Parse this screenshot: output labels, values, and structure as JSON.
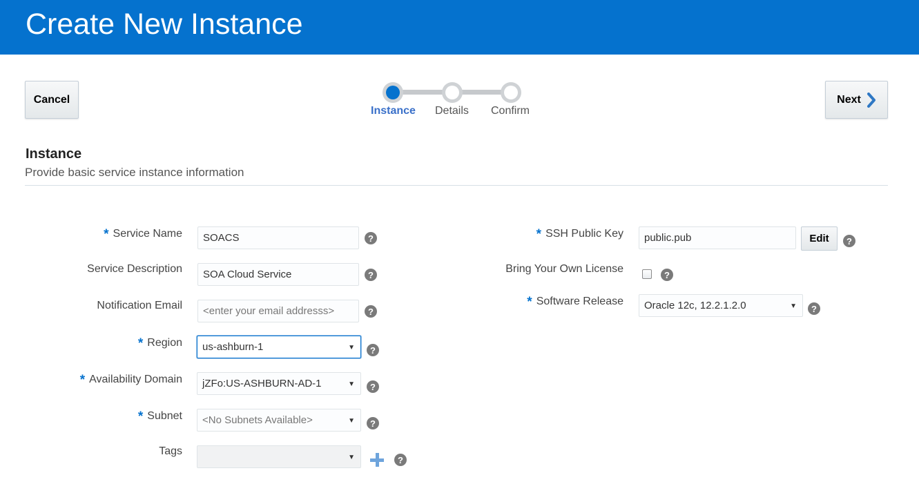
{
  "header": {
    "title": "Create New Instance"
  },
  "toolbar": {
    "cancel_label": "Cancel",
    "next_label": "Next"
  },
  "train": {
    "steps": [
      "Instance",
      "Details",
      "Confirm"
    ],
    "active": "Instance"
  },
  "section": {
    "title": "Instance",
    "subtitle": "Provide basic service instance information"
  },
  "form": {
    "service_name": {
      "label": "Service Name",
      "value": "SOACS",
      "required": "*"
    },
    "service_description": {
      "label": "Service Description",
      "value": "SOA Cloud Service"
    },
    "notification_email": {
      "label": "Notification Email",
      "placeholder": "<enter your email addresss>"
    },
    "region": {
      "label": "Region",
      "value": "us-ashburn-1",
      "required": "*"
    },
    "availability_domain": {
      "label": "Availability Domain",
      "value": "jZFo:US-ASHBURN-AD-1",
      "required": "*"
    },
    "subnet": {
      "label": "Subnet",
      "value": "<No Subnets Available>",
      "required": "*"
    },
    "tags": {
      "label": "Tags",
      "value": ""
    },
    "ssh_public_key": {
      "label": "SSH Public Key",
      "value": "public.pub",
      "required": "*",
      "edit_label": "Edit"
    },
    "byol": {
      "label": "Bring Your Own License",
      "checked": false
    },
    "software_release": {
      "label": "Software Release",
      "value": "Oracle 12c, 12.2.1.2.0",
      "required": "*"
    }
  },
  "icons": {
    "help": "?",
    "caret": "▼"
  },
  "colors": {
    "header_bg": "#0572ce",
    "accent": "#0572ce",
    "required": "#0572ce"
  }
}
